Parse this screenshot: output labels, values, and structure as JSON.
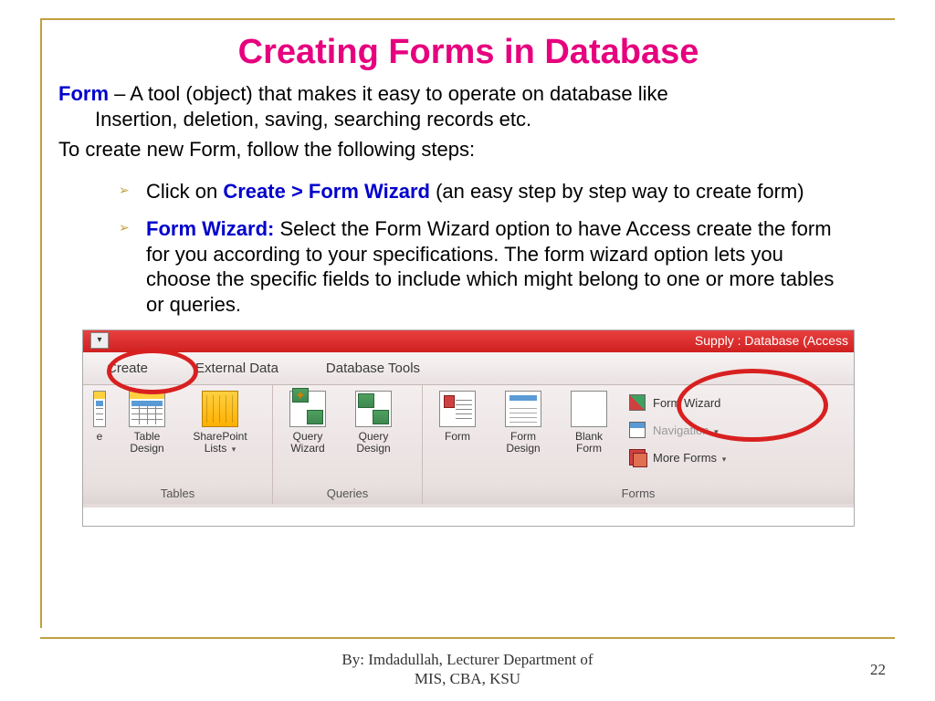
{
  "title": "Creating Forms in Database",
  "para1_term": "Form",
  "para1_dash": " – A tool (object) that makes it easy to operate on database like",
  "para1_line2": "Insertion, deletion, saving, searching records etc.",
  "para2": "To create new Form, follow the following steps:",
  "bullet1_pre": "Click on ",
  "bullet1_bold": "Create > Form Wizard",
  "bullet1_post": " (an easy step by step way to create form)",
  "bullet2_bold": "Form Wizard:",
  "bullet2_rest": " Select the Form Wizard option to have Access create the form for you according to your specifications. The form wizard option lets you choose the specific fields to include which might belong to one or more tables or queries.",
  "screenshot": {
    "titlebar": "Supply : Database (Access",
    "qat_drop": "▾",
    "tabs": {
      "create": "Create",
      "external": "External Data",
      "dbtools": "Database Tools"
    },
    "groups": {
      "tables": "Tables",
      "queries": "Queries",
      "forms": "Forms"
    },
    "buttons": {
      "partial_e": "e",
      "table_design": "Table Design",
      "sharepoint": "SharePoint Lists",
      "query_wizard": "Query Wizard",
      "query_design": "Query Design",
      "form": "Form",
      "form_design": "Form Design",
      "blank_form": "Blank Form",
      "form_wizard": "Form Wizard",
      "navigation": "Navigation",
      "more_forms": "More Forms"
    },
    "caret": "▾"
  },
  "footer_line1": "By: Imdadullah, Lecturer Department of",
  "footer_line2": "MIS, CBA, KSU",
  "page_number": "22"
}
